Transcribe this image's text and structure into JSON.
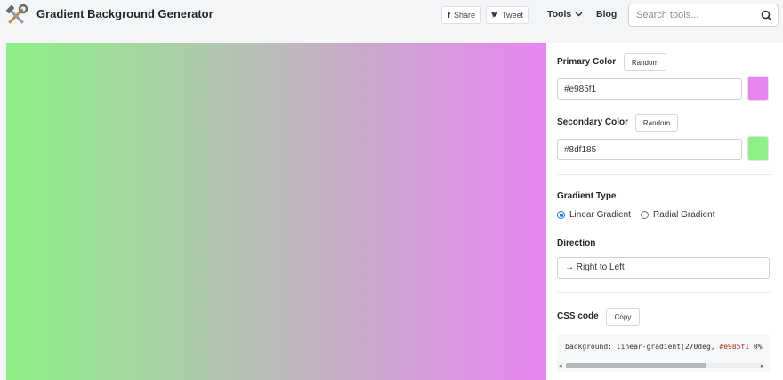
{
  "header": {
    "title": "Gradient Background Generator",
    "logo_icon": "hammer-wrench-icon",
    "share_label": "Share",
    "tweet_label": "Tweet",
    "nav_tools": "Tools",
    "nav_blog": "Blog",
    "search_placeholder": "Search tools..."
  },
  "preview": {
    "gradient_colors": [
      "#e985f1",
      "#8df185"
    ]
  },
  "panel": {
    "primary_label": "Primary Color",
    "primary_random": "Random",
    "primary_value": "#e985f1",
    "primary_swatch": "#e985f1",
    "secondary_label": "Secondary Color",
    "secondary_random": "Random",
    "secondary_value": "#8df185",
    "secondary_swatch": "#8df185",
    "gradient_type_label": "Gradient Type",
    "gradient_options": [
      "Linear Gradient",
      "Radial Gradient"
    ],
    "gradient_selected": "Linear Gradient",
    "direction_label": "Direction",
    "direction_value": "→ Right to Left",
    "css_label": "CSS code",
    "copy_label": "Copy",
    "css_prefix": "background: linear-gradient(270deg, ",
    "css_color": "#e985f1",
    "css_suffix": " 0%"
  },
  "colors": {
    "accent": "#1a73e8",
    "page_bg": "#f4f5f7"
  }
}
